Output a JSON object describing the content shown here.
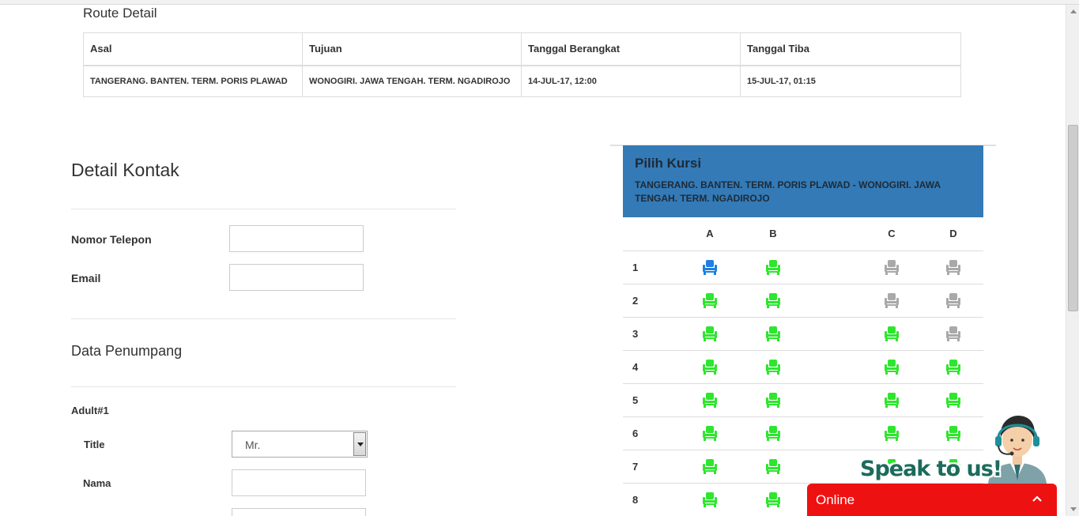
{
  "route": {
    "title": "Route Detail",
    "headers": [
      "Asal",
      "Tujuan",
      "Tanggal Berangkat",
      "Tanggal Tiba"
    ],
    "row": [
      "TANGERANG. BANTEN. TERM. PORIS PLAWAD",
      "WONOGIRI. JAWA TENGAH. TERM. NGADIROJO",
      "14-JUL-17, 12:00",
      "15-JUL-17, 01:15"
    ]
  },
  "contact": {
    "heading": "Detail Kontak",
    "phone_label": "Nomor Telepon",
    "phone_value": "",
    "email_label": "Email",
    "email_value": ""
  },
  "passenger": {
    "heading": "Data Penumpang",
    "adult_label": "Adult#1",
    "title_label": "Title",
    "title_value": "Mr.",
    "name_label": "Nama",
    "name_value": ""
  },
  "seats": {
    "title": "Pilih Kursi",
    "subtitle": "TANGERANG. BANTEN. TERM. PORIS PLAWAD - WONOGIRI. JAWA TENGAH. TERM. NGADIROJO",
    "columns": [
      "A",
      "B",
      "C",
      "D"
    ],
    "status_colors": {
      "selected": "#1e7fe0",
      "available": "#2ee62e",
      "taken": "#a9a9a9"
    },
    "rows": [
      {
        "num": "1",
        "A": "selected",
        "B": "available",
        "C": "taken",
        "D": "taken"
      },
      {
        "num": "2",
        "A": "available",
        "B": "available",
        "C": "taken",
        "D": "taken"
      },
      {
        "num": "3",
        "A": "available",
        "B": "available",
        "C": "available",
        "D": "taken"
      },
      {
        "num": "4",
        "A": "available",
        "B": "available",
        "C": "available",
        "D": "available"
      },
      {
        "num": "5",
        "A": "available",
        "B": "available",
        "C": "available",
        "D": "available"
      },
      {
        "num": "6",
        "A": "available",
        "B": "available",
        "C": "available",
        "D": "available"
      },
      {
        "num": "7",
        "A": "available",
        "B": "available",
        "C": "available",
        "D": "available"
      },
      {
        "num": "8",
        "A": "available",
        "B": "available",
        "C": "available",
        "D": "available"
      }
    ]
  },
  "chat": {
    "speak_text": "Speak to us!",
    "status": "Online"
  }
}
